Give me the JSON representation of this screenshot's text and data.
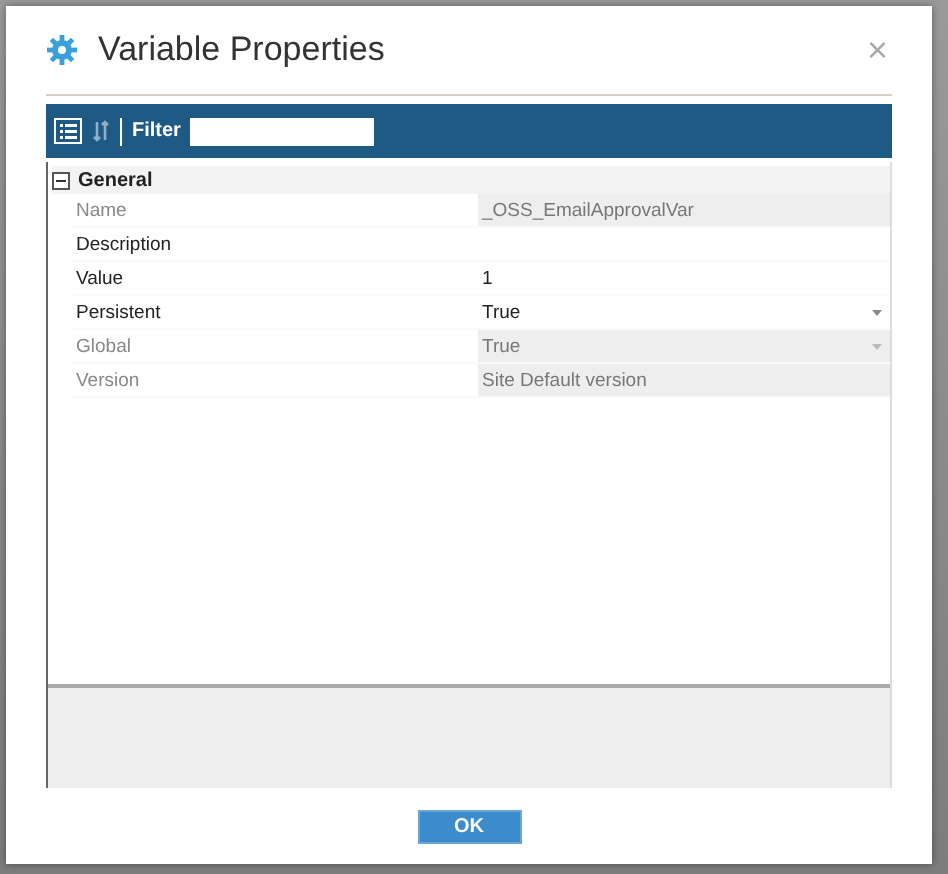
{
  "window": {
    "title": "Variable Properties",
    "close": "×"
  },
  "toolbar": {
    "filter_label": "Filter"
  },
  "category": {
    "label": "General",
    "expanded": true,
    "properties": [
      {
        "name": "Name",
        "value": "_OSS_EmailApprovalVar",
        "disabled": true,
        "kind": "text"
      },
      {
        "name": "Description",
        "disabled": false,
        "kind": "text"
      },
      {
        "name": "Value",
        "value": "1",
        "disabled": false,
        "kind": "text"
      },
      {
        "name": "Persistent",
        "value": "True",
        "disabled": false,
        "kind": "dropdown"
      },
      {
        "name": "Global",
        "value": "True",
        "disabled": true,
        "kind": "dropdown"
      },
      {
        "name": "Version",
        "value": "Site Default version",
        "disabled": true,
        "kind": "text"
      }
    ]
  },
  "buttons": [
    "OK"
  ]
}
